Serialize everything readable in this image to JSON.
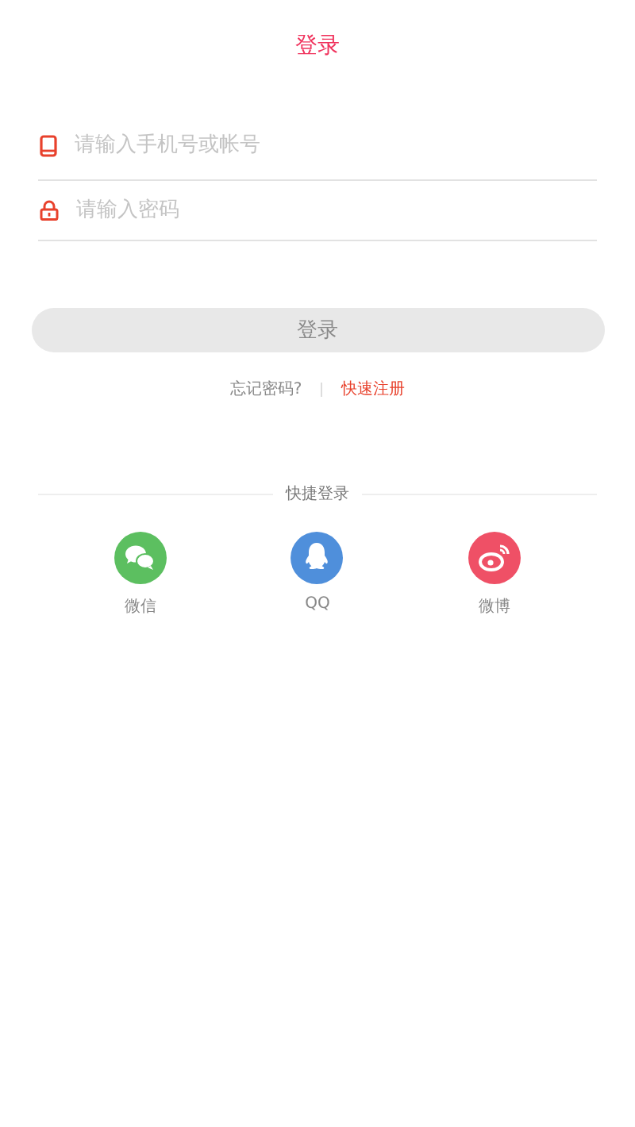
{
  "title": "登录",
  "fields": [
    {
      "kind": "phone",
      "placeholder": "请输入手机号或帐号"
    },
    {
      "kind": "password",
      "placeholder": "请输入密码"
    }
  ],
  "login_button": {
    "label": "登录",
    "disabled": true
  },
  "links": {
    "forgot": "忘记密码?",
    "register": "快速注册"
  },
  "quick_login": {
    "title": "快捷登录",
    "options": [
      {
        "kind": "wechat",
        "label": "微信",
        "color": "#5cbf60"
      },
      {
        "kind": "qq",
        "label": "QQ",
        "color": "#4f8fdb"
      },
      {
        "kind": "weibo",
        "label": "微博",
        "color": "#ef5066"
      }
    ]
  }
}
